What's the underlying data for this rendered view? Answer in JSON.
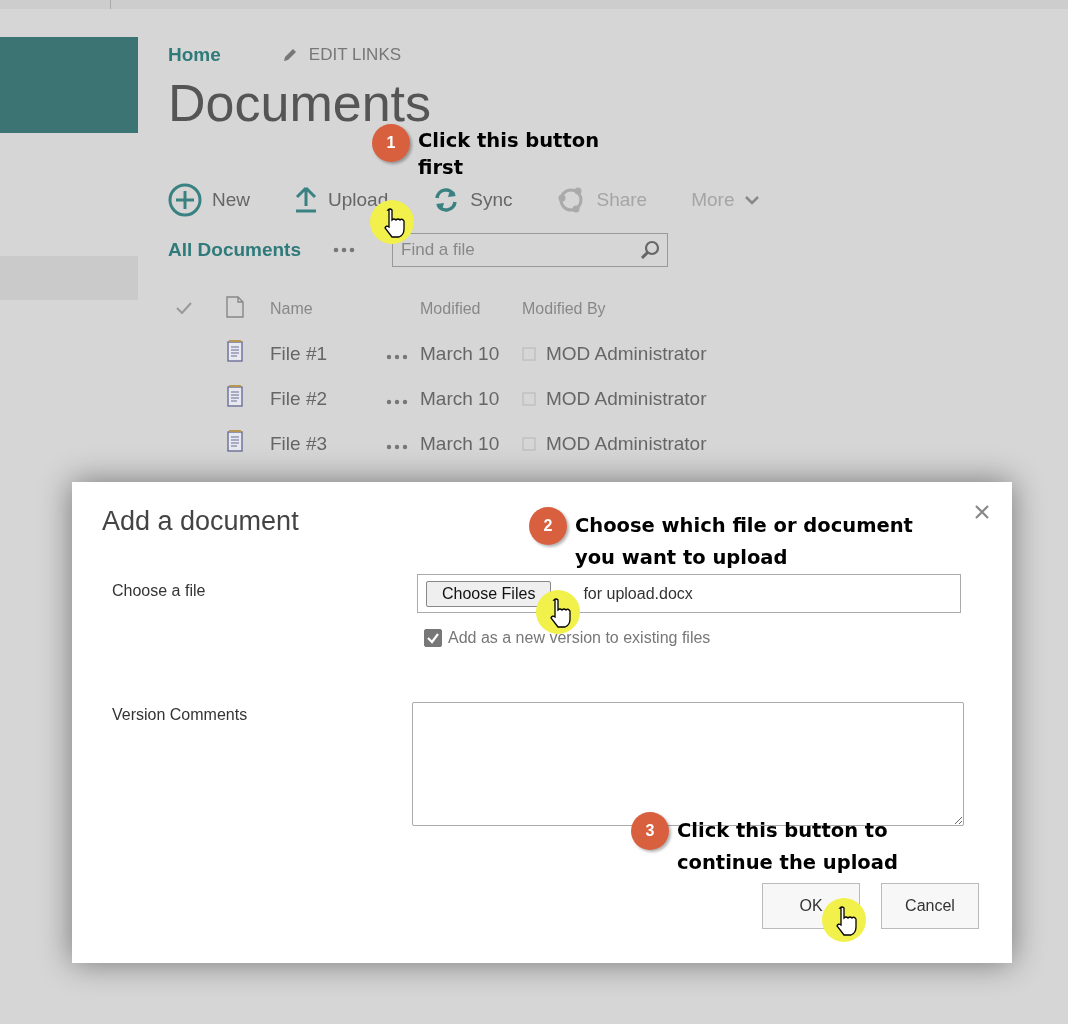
{
  "breadcrumb": {
    "home": "Home",
    "edit_links": "EDIT LINKS"
  },
  "title": "Documents",
  "toolbar": [
    {
      "kind": "new",
      "label": "New",
      "disabled": false
    },
    {
      "kind": "upload",
      "label": "Upload",
      "disabled": false
    },
    {
      "kind": "sync",
      "label": "Sync",
      "disabled": false
    },
    {
      "kind": "share",
      "label": "Share",
      "disabled": true
    },
    {
      "kind": "more",
      "label": "More",
      "disabled": true
    }
  ],
  "view": {
    "label": "All Documents"
  },
  "search": {
    "placeholder": "Find a file"
  },
  "table": {
    "columns": [
      "Name",
      "Modified",
      "Modified By"
    ],
    "rows": [
      {
        "name": "File #1",
        "modified": "March 10",
        "modified_by": "MOD Administrator"
      },
      {
        "name": "File #2",
        "modified": "March 10",
        "modified_by": "MOD Administrator"
      },
      {
        "name": "File #3",
        "modified": "March 10",
        "modified_by": "MOD Administrator"
      }
    ]
  },
  "dialog": {
    "title": "Add a document",
    "file_label": "Choose a file",
    "choose_button": "Choose Files",
    "file_name": "for upload.docx",
    "version_checkbox": {
      "label": "Add as a new version to existing files",
      "checked": true
    },
    "comments_label": "Version Comments",
    "buttons": [
      "OK",
      "Cancel"
    ]
  },
  "callouts": [
    {
      "number": "1",
      "lines": [
        "Click this button",
        "first"
      ]
    },
    {
      "number": "2",
      "lines": [
        "Choose which file or document",
        "you want to upload"
      ]
    },
    {
      "number": "3",
      "lines": [
        "Click this button to",
        "continue the upload"
      ]
    }
  ]
}
